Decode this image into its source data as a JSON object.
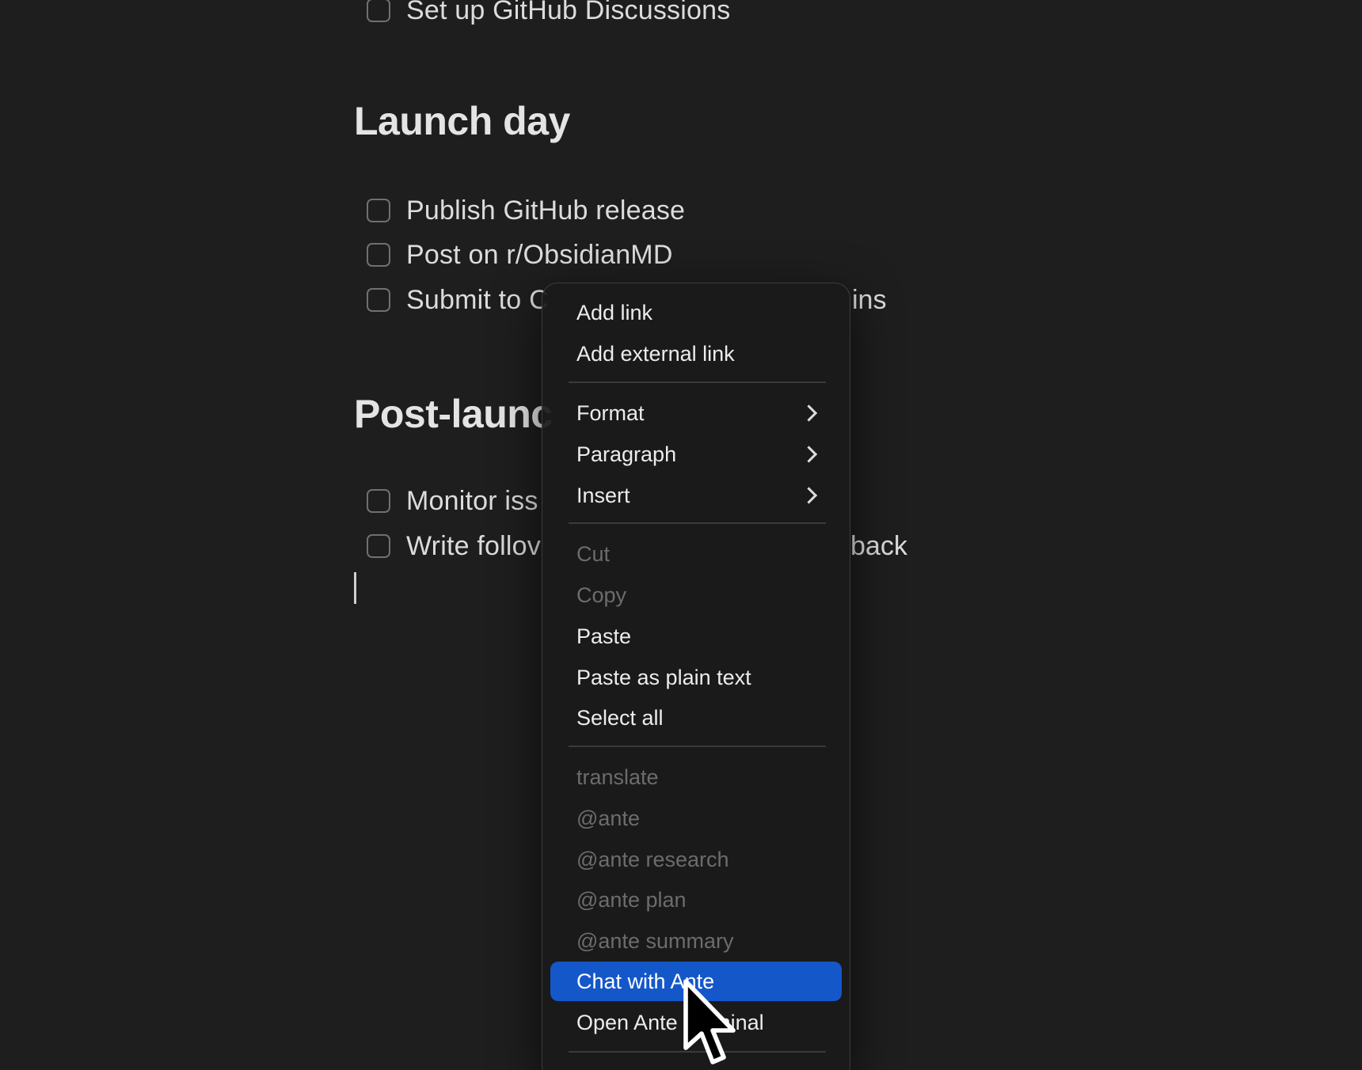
{
  "tasks_top": [
    {
      "label": "Set up GitHub Discussions",
      "checked": false
    }
  ],
  "launch_day": {
    "heading": "Launch day",
    "tasks": [
      {
        "label": "Publish GitHub release",
        "checked": false
      },
      {
        "label": "Post on r/ObsidianMD",
        "checked": false
      },
      {
        "label": "Submit to C",
        "checked": false,
        "tail": "ins"
      }
    ]
  },
  "post_launch": {
    "heading": "Post-launc",
    "tasks": [
      {
        "label": "Monitor iss",
        "checked": false
      },
      {
        "label": "Write follov",
        "checked": false,
        "tail": "back"
      }
    ]
  },
  "context_menu": {
    "items": [
      {
        "label": "Add link",
        "enabled": true
      },
      {
        "label": "Add external link",
        "enabled": true
      },
      {
        "label": "Format",
        "enabled": true,
        "submenu": true
      },
      {
        "label": "Paragraph",
        "enabled": true,
        "submenu": true
      },
      {
        "label": "Insert",
        "enabled": true,
        "submenu": true
      },
      {
        "label": "Cut",
        "enabled": false
      },
      {
        "label": "Copy",
        "enabled": false
      },
      {
        "label": "Paste",
        "enabled": true
      },
      {
        "label": "Paste as plain text",
        "enabled": true
      },
      {
        "label": "Select all",
        "enabled": true
      },
      {
        "label": "translate",
        "enabled": false
      },
      {
        "label": "@ante",
        "enabled": false
      },
      {
        "label": "@ante research",
        "enabled": false
      },
      {
        "label": "@ante plan",
        "enabled": false
      },
      {
        "label": "@ante summary",
        "enabled": false
      },
      {
        "label": "Chat with Ante",
        "enabled": true,
        "highlighted": true
      },
      {
        "label": "Open Ante Terminal",
        "enabled": true
      }
    ]
  },
  "colors": {
    "background": "#1e1e1e",
    "menu_background": "#1a1a1a",
    "highlight": "#1457c9",
    "disabled_text": "#6c6c6c"
  }
}
